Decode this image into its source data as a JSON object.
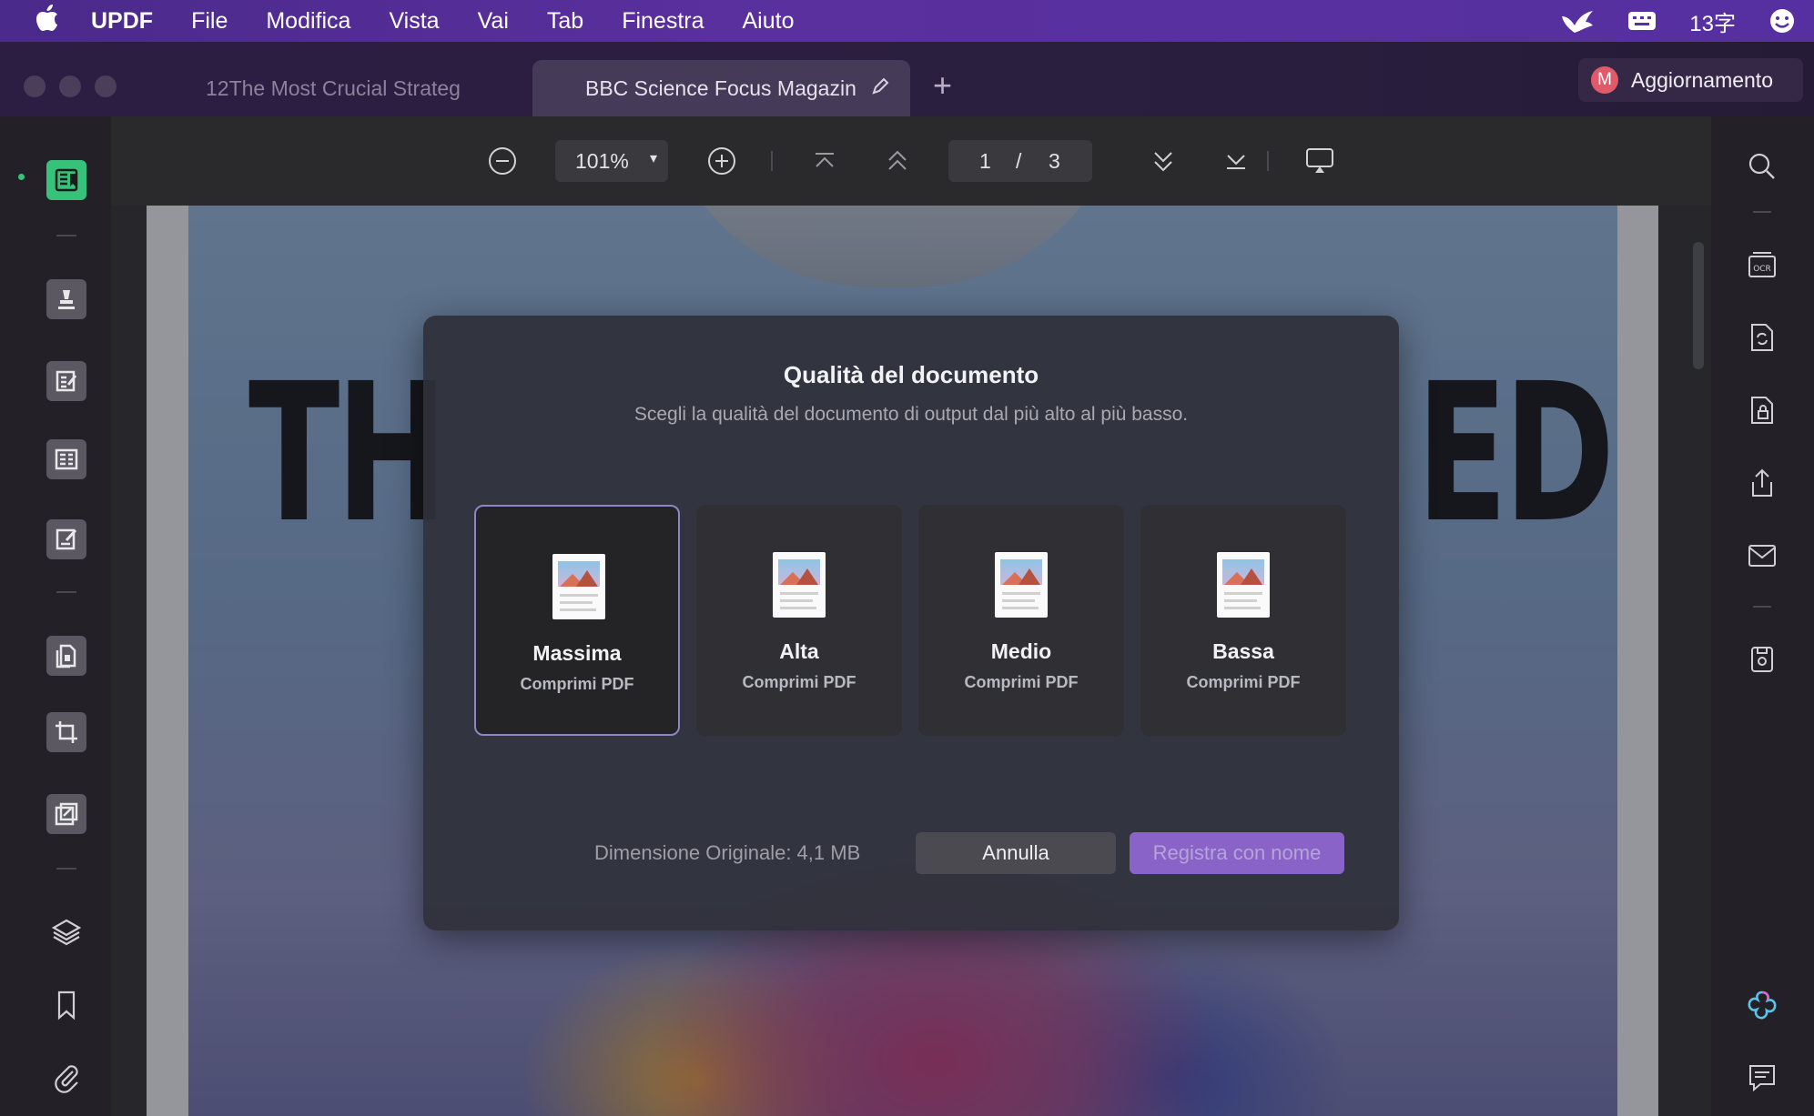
{
  "menubar": {
    "app_name": "UPDF",
    "items": [
      "File",
      "Modifica",
      "Vista",
      "Vai",
      "Tab",
      "Finestra",
      "Aiuto"
    ],
    "status_text": "13字"
  },
  "tabs": [
    {
      "title": "12The Most Crucial Strateg",
      "active": false
    },
    {
      "title": "BBC Science Focus Magazin",
      "active": true
    }
  ],
  "update_button": {
    "avatar_letter": "M",
    "label": "Aggiornamento"
  },
  "toolbar": {
    "zoom": "101%",
    "current_page": "1",
    "page_separator": "/",
    "total_pages": "3"
  },
  "document": {
    "headline_left": "TH",
    "headline_right": "ED"
  },
  "dialog": {
    "title": "Qualità del documento",
    "subtitle": "Scegli la qualità del documento di output dal più alto al più basso.",
    "options": [
      {
        "name": "Massima",
        "desc": "Comprimi PDF",
        "selected": true
      },
      {
        "name": "Alta",
        "desc": "Comprimi PDF",
        "selected": false
      },
      {
        "name": "Medio",
        "desc": "Comprimi PDF",
        "selected": false
      },
      {
        "name": "Bassa",
        "desc": "Comprimi PDF",
        "selected": false
      }
    ],
    "original_size": "Dimensione Originale: 4,1 MB",
    "cancel_label": "Annulla",
    "save_label": "Registra con nome"
  },
  "colors": {
    "accent_green": "#36c27a",
    "accent_purple": "#8a63c9",
    "selected_border": "#8e85c7"
  }
}
